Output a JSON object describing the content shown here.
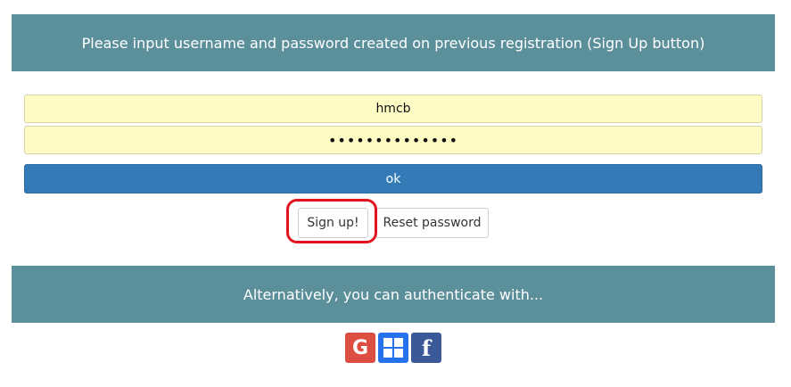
{
  "header": {
    "instruction": "Please input username and password created on previous registration (Sign Up button)"
  },
  "form": {
    "username_value": "hmcb",
    "password_value": "••••••••••••••",
    "ok_label": "ok"
  },
  "actions": {
    "signup_label": "Sign up!",
    "reset_label": "Reset password"
  },
  "alternative": {
    "text": "Alternatively, you can authenticate with..."
  },
  "social": {
    "google_glyph": "G",
    "facebook_glyph": "f",
    "icons": [
      "google-icon",
      "windows-icon",
      "facebook-icon"
    ]
  },
  "colors": {
    "banner": "#5b8f9a",
    "primary": "#337ab7",
    "field_bg": "#fefcc4",
    "highlight": "#e0141e",
    "google": "#dc4e41",
    "windows": "#2672ec",
    "facebook": "#3b5998"
  }
}
